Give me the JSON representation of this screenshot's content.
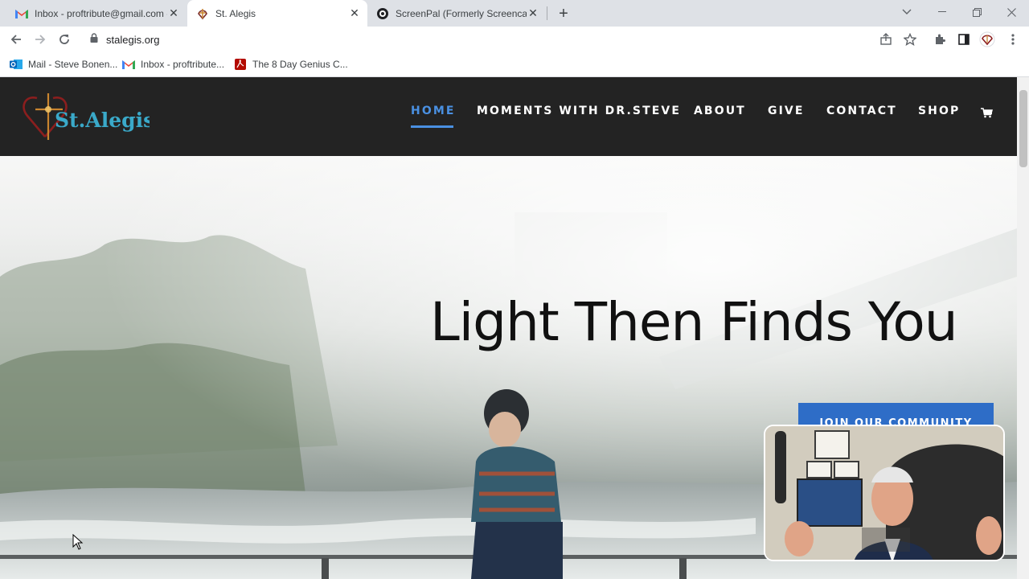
{
  "browser": {
    "tabs": [
      {
        "title": "Inbox - proftribute@gmail.com - ",
        "icon": "gmail-icon"
      },
      {
        "title": "St. Alegis",
        "icon": "st-alegis-favicon"
      },
      {
        "title": "ScreenPal (Formerly Screencast-O",
        "icon": "screenpal-icon"
      }
    ],
    "url": "stalegis.org",
    "bookmarks": [
      {
        "label": "Mail - Steve Bonen...",
        "icon": "outlook-icon"
      },
      {
        "label": "Inbox - proftribute...",
        "icon": "gmail-icon"
      },
      {
        "label": "The 8 Day Genius C...",
        "icon": "pdf-icon"
      }
    ]
  },
  "site": {
    "logo_text": "St.Alegis",
    "nav": [
      "HOME",
      "MOMENTS WITH DR.STEVE",
      "ABOUT",
      "GIVE",
      "CONTACT",
      "SHOP"
    ],
    "active_nav": "HOME",
    "accent_color": "#4a90e2",
    "header_bg": "#232323"
  },
  "hero": {
    "headline": "Light Then Finds You",
    "cta_label": "JOIN OUR COMMUNITY",
    "cta_color": "#2e6dc7"
  }
}
